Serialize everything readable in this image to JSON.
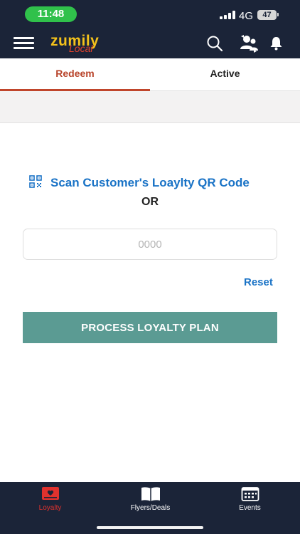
{
  "status_bar": {
    "time": "11:48",
    "network": "4G",
    "battery": "47"
  },
  "header": {
    "logo_main": "zumily",
    "logo_sub": "Local",
    "icons": [
      "menu-icon",
      "search-icon",
      "user-switch-icon",
      "bell-icon"
    ]
  },
  "tabs": [
    {
      "label": "Redeem",
      "selected": true
    },
    {
      "label": "Active",
      "selected": false
    }
  ],
  "main": {
    "scan_label": "Scan Customer's Loaylty QR Code",
    "or_label": "OR",
    "code_input": {
      "value": "",
      "placeholder": "0000"
    },
    "reset_label": "Reset",
    "process_label": "PROCESS LOYALTY PLAN"
  },
  "bottom_nav": [
    {
      "label": "Loyalty",
      "icon": "loyalty-card-icon",
      "selected": true
    },
    {
      "label": "Flyers/Deals",
      "icon": "book-icon",
      "selected": false
    },
    {
      "label": "Events",
      "icon": "calendar-icon",
      "selected": false
    }
  ],
  "colors": {
    "header_bg": "#1b2438",
    "accent_red": "#c0452b",
    "link_blue": "#1a73c6",
    "button_teal": "#5b9b93",
    "time_pill": "#30c14b"
  }
}
